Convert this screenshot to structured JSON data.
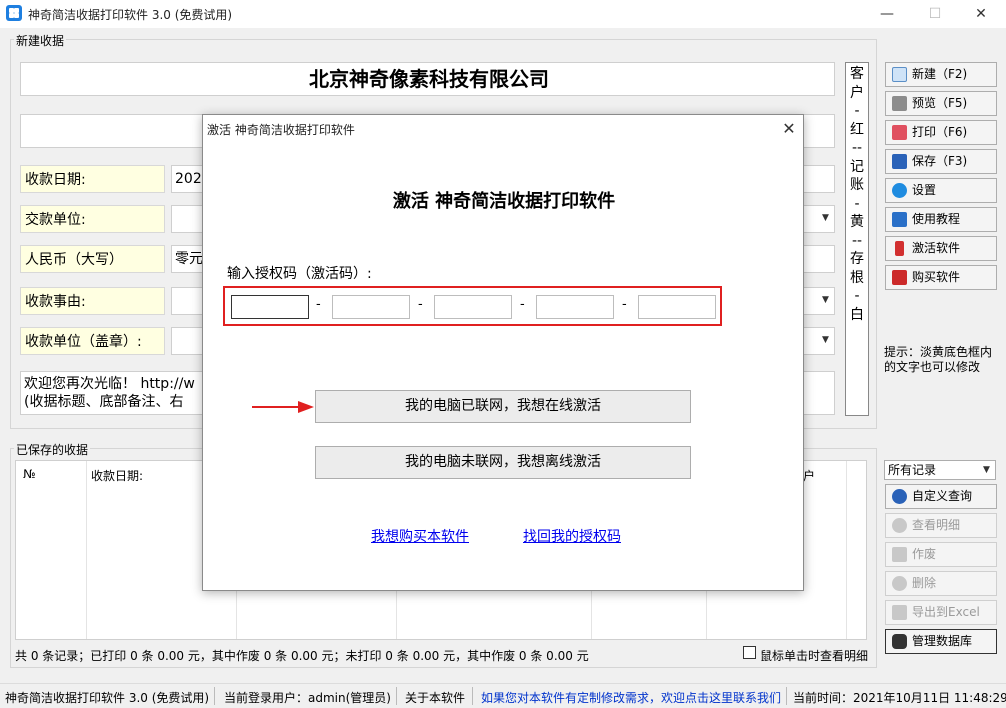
{
  "window": {
    "title": "神奇简洁收据打印软件 3.0 (免费试用)",
    "min": "—",
    "max": "☐",
    "close": "✕"
  },
  "new_receipt": {
    "group_label": "新建收据",
    "company": "北京神奇像素科技有限公司",
    "rows": [
      {
        "label": "收款日期:",
        "value": "2021"
      },
      {
        "label": "交款单位:",
        "value": ""
      },
      {
        "label": "人民币（大写）",
        "value": "零元"
      },
      {
        "label": "收款事由:",
        "value": ""
      },
      {
        "label": "收款单位（盖章）:",
        "value": ""
      }
    ],
    "remark_line1": "欢迎您再次光临！ http://w",
    "remark_line2": "(收据标题、底部备注、右",
    "copies_text": [
      "客",
      "户",
      "-",
      "红",
      "--",
      "记",
      "账",
      "-",
      "黄",
      "--",
      "存",
      "根",
      "-",
      "白"
    ]
  },
  "toolbar": {
    "new": "新建（F2)",
    "preview": "预览（F5)",
    "print": "打印（F6)",
    "save": "保存（F3)",
    "settings": "设置",
    "tutorial": "使用教程",
    "activate": "激活软件",
    "buy": "购买软件",
    "hint": "提示：淡黄底色框内的文字也可以修改"
  },
  "saved": {
    "group_label": "已保存的收据",
    "columns": [
      "№",
      "收款日期:"
    ],
    "col_last_fragment": "户",
    "filter": "所有记录",
    "custom_query": "自定义查询",
    "view_detail": "查看明细",
    "void": "作废",
    "delete": "删除",
    "export": "导出到Excel",
    "manage_db": "管理数据库",
    "summary": "共 0 条记录；已打印 0 条 0.00 元，其中作废 0 条 0.00 元；未打印 0 条 0.00 元，其中作废 0 条 0.00 元",
    "click_detail": "鼠标单击时查看明细"
  },
  "dialog": {
    "title": "激活 神奇简洁收据打印软件",
    "heading": "激活 神奇简洁收据打印软件",
    "prompt": "输入授权码（激活码）:",
    "code_fields": [
      "",
      "",
      "",
      "",
      ""
    ],
    "online_btn": "我的电脑已联网，我想在线激活",
    "offline_btn": "我的电脑未联网，我想离线激活",
    "buy_link": "我想购买本软件",
    "recover_link": "找回我的授权码"
  },
  "status": {
    "app": "神奇简洁收据打印软件 3.0 (免费试用)",
    "user": "当前登录用户：admin(管理员)",
    "about": "关于本软件",
    "contact": "如果您对本软件有定制修改需求，欢迎点击这里联系我们",
    "time": "当前时间：2021年10月11日 11:48:29"
  },
  "colors": {
    "label_bg": "#ffffe1",
    "highlight_red": "#e02020",
    "link_blue": "#0000ee"
  }
}
